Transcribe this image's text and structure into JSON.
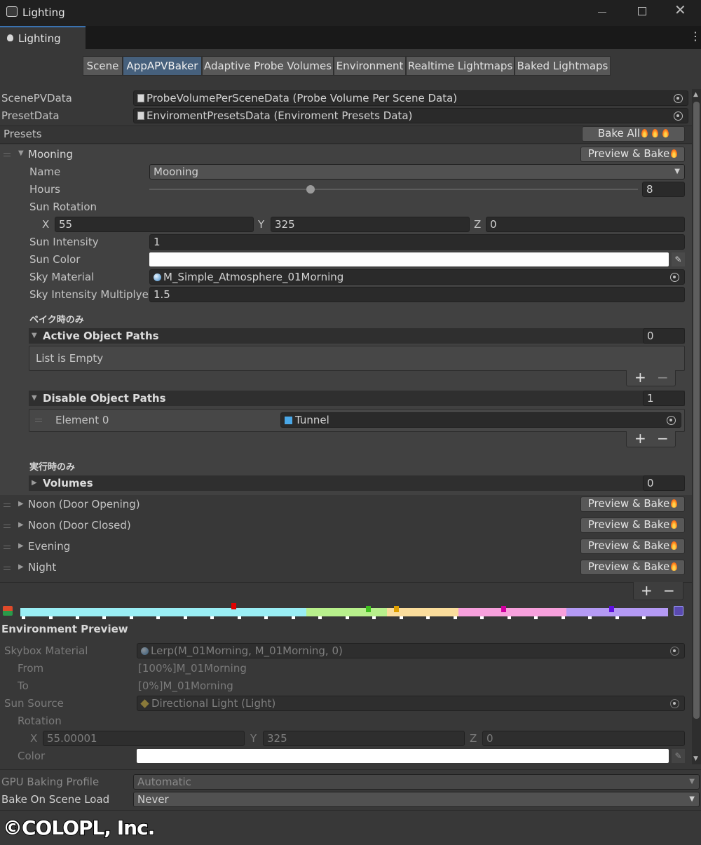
{
  "window": {
    "title": "Lighting",
    "tab": "Lighting"
  },
  "tabs": [
    "Scene",
    "AppAPVBaker",
    "Adaptive Probe Volumes",
    "Environment",
    "Realtime Lightmaps",
    "Baked Lightmaps"
  ],
  "scene_pv_data": {
    "label": "ScenePVData",
    "value": "ProbeVolumePerSceneData (Probe Volume Per Scene Data)"
  },
  "preset_data": {
    "label": "PresetData",
    "value": "EnviromentPresetsData (Enviroment Presets Data)"
  },
  "presets": {
    "label": "Presets",
    "bake_all": "Bake All"
  },
  "preview_bake": "Preview & Bake",
  "mooning": {
    "title": "Mooning",
    "name_label": "Name",
    "name_value": "Mooning",
    "hours_label": "Hours",
    "hours_value": "8",
    "hours_fraction": 0.33,
    "sun_rotation_label": "Sun Rotation",
    "x_label": "X",
    "x": "55",
    "y_label": "Y",
    "y": "325",
    "z_label": "Z",
    "z": "0",
    "sun_intensity_label": "Sun Intensity",
    "sun_intensity": "1",
    "sun_color_label": "Sun Color",
    "sun_color": "#ffffff",
    "sky_material_label": "Sky Material",
    "sky_material": "M_Simple_Atmosphere_01Morning",
    "sky_mult_label": "Sky Intensity Multiplyer",
    "sky_mult": "1.5",
    "bake_only": "ベイク時のみ",
    "active_paths": {
      "label": "Active Object Paths",
      "count": "0",
      "empty": "List is Empty"
    },
    "disable_paths": {
      "label": "Disable Object Paths",
      "count": "1",
      "element_label": "Element 0",
      "element_value": "Tunnel"
    },
    "runtime_only": "実行時のみ",
    "volumes": {
      "label": "Volumes",
      "count": "0"
    }
  },
  "collapsed_presets": [
    "Noon (Door Opening)",
    "Noon (Door Closed)",
    "Evening",
    "Night"
  ],
  "plus": "+",
  "minus": "−",
  "timeline": {
    "colors": [
      "#9aeef4",
      "#b8f08c",
      "#fbdd9c",
      "#f7a0dc",
      "#b49af4"
    ],
    "markers": [
      "#e00000",
      "#40c020",
      "#e0a000",
      "#d000a0",
      "#6010e0"
    ]
  },
  "env_preview": {
    "title": "Environment Preview",
    "skybox_label": "Skybox Material",
    "skybox": "Lerp(M_01Morning, M_01Morning, 0)",
    "from_label": "From",
    "from": "[100%]M_01Morning",
    "to_label": "To",
    "to": "[0%]M_01Morning",
    "sun_source_label": "Sun Source",
    "sun_source": "Directional Light (Light)",
    "rotation_label": "Rotation",
    "x_label": "X",
    "x": "55.00001",
    "y_label": "Y",
    "y": "325",
    "z_label": "Z",
    "z": "0",
    "color_label": "Color",
    "color": "#ffffff"
  },
  "gpu_profile": {
    "label": "GPU Baking Profile",
    "value": "Automatic"
  },
  "bake_on_load": {
    "label": "Bake On Scene Load",
    "value": "Never"
  },
  "copyright": "©COLOPL, Inc."
}
